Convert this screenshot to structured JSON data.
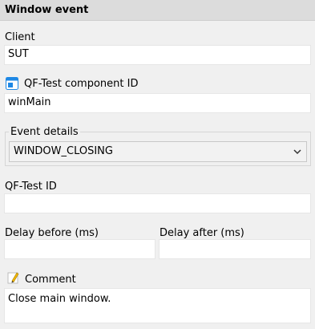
{
  "header": {
    "title": "Window event"
  },
  "client": {
    "label": "Client",
    "value": "SUT"
  },
  "component": {
    "label": "QF-Test component ID",
    "value": "winMain",
    "icon": "component-id-icon"
  },
  "event_details": {
    "legend": "Event details",
    "selected": "WINDOW_CLOSING"
  },
  "qftest_id": {
    "label": "QF-Test ID",
    "value": ""
  },
  "delay_before": {
    "label": "Delay before (ms)",
    "value": ""
  },
  "delay_after": {
    "label": "Delay after (ms)",
    "value": ""
  },
  "comment": {
    "label": "Comment",
    "value": "Close main window.",
    "icon": "pencil-icon"
  },
  "colors": {
    "header_bg": "#dcdcdc",
    "panel_bg": "#f0f0f0",
    "field_bg": "#ffffff",
    "icon_blue": "#1e88e5",
    "pencil_yellow": "#f2b705"
  }
}
